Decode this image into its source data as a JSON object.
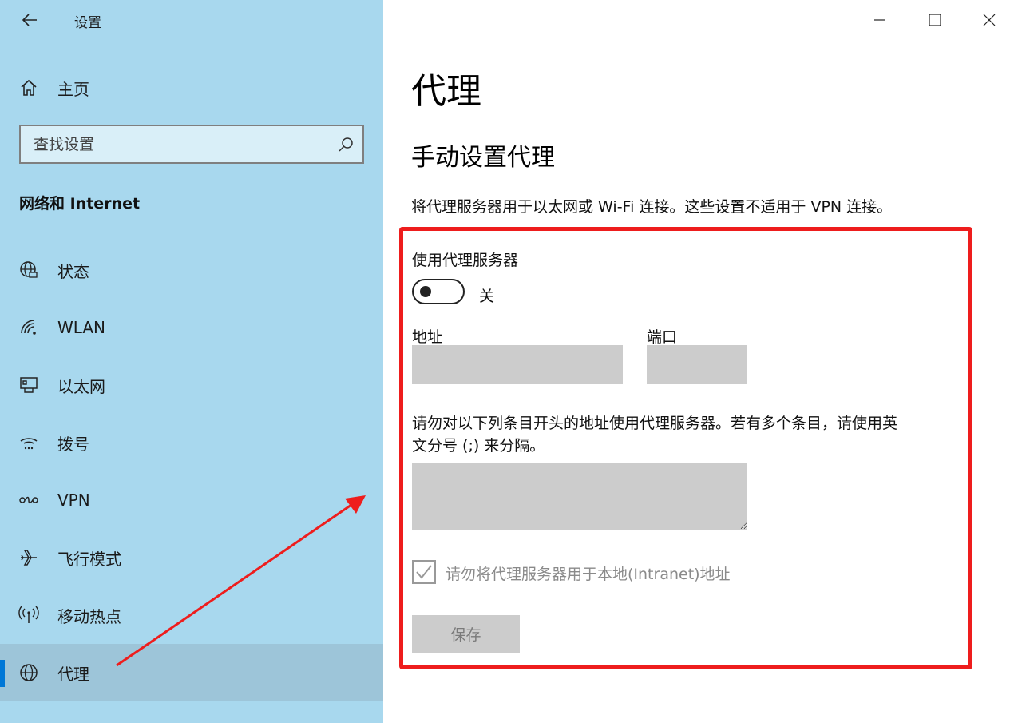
{
  "window": {
    "title": "设置"
  },
  "sidebar": {
    "home_label": "主页",
    "search_placeholder": "查找设置",
    "section_heading": "网络和 Internet",
    "items": [
      {
        "label": "状态",
        "icon": "status-globe-icon"
      },
      {
        "label": "WLAN",
        "icon": "wifi-icon"
      },
      {
        "label": "以太网",
        "icon": "ethernet-icon"
      },
      {
        "label": "拨号",
        "icon": "dialup-icon"
      },
      {
        "label": "VPN",
        "icon": "vpn-icon"
      },
      {
        "label": "飞行模式",
        "icon": "airplane-icon"
      },
      {
        "label": "移动热点",
        "icon": "hotspot-icon"
      },
      {
        "label": "代理",
        "icon": "globe-icon",
        "selected": true
      }
    ]
  },
  "main": {
    "page_title": "代理",
    "section_title": "手动设置代理",
    "description": "将代理服务器用于以太网或 Wi-Fi 连接。这些设置不适用于 VPN 连接。",
    "use_proxy_label": "使用代理服务器",
    "toggle_state_label": "关",
    "address_label": "地址",
    "port_label": "端口",
    "exceptions_label_line1": "请勿对以下列条目开头的地址使用代理服务器。若有多个条目，请使用英",
    "exceptions_label_line2": "文分号 (;) 来分隔。",
    "local_checkbox_label": "请勿将代理服务器用于本地(Intranet)地址",
    "save_label": "保存"
  },
  "colors": {
    "sidebar_bg": "#a8d8ee",
    "accent": "#0078d7",
    "annotation_red": "#ee1d1d",
    "disabled_gray": "#cccccc"
  }
}
